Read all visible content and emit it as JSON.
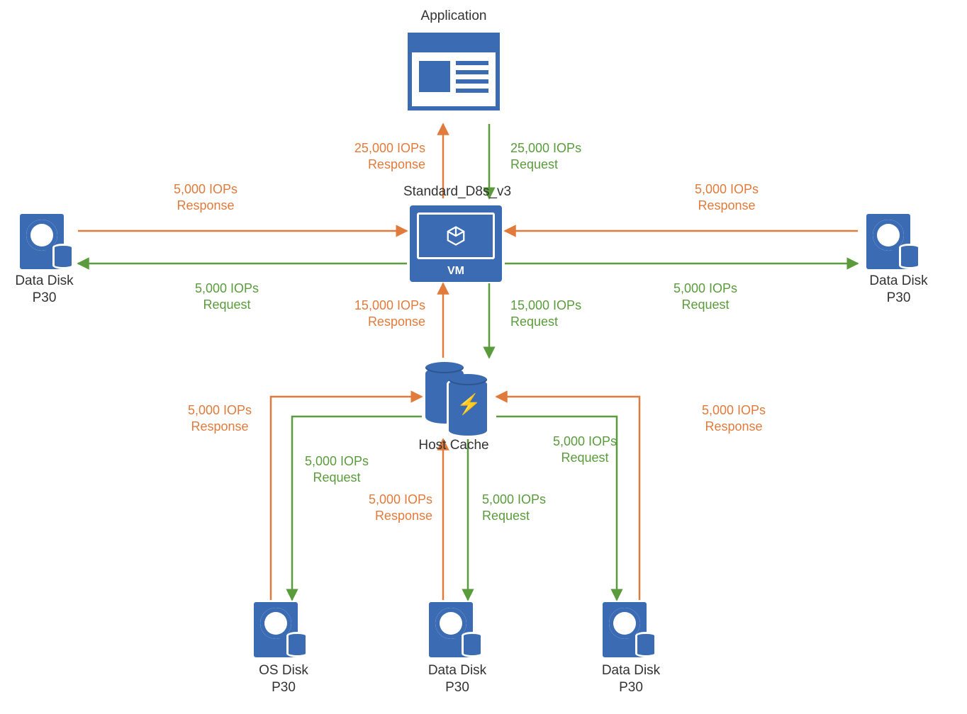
{
  "colors": {
    "orange": "#e07b3c",
    "green": "#5a9b3c",
    "blue": "#3b6cb3"
  },
  "nodes": {
    "application": {
      "label": "Application"
    },
    "vm": {
      "label_top": "Standard_D8s_v3",
      "label_inside": "VM"
    },
    "host_cache": {
      "label": "Host Cache"
    },
    "disk_left": {
      "line1": "Data Disk",
      "line2": "P30"
    },
    "disk_right": {
      "line1": "Data Disk",
      "line2": "P30"
    },
    "bottom_os": {
      "line1": "OS Disk",
      "line2": "P30"
    },
    "bottom_data1": {
      "line1": "Data Disk",
      "line2": "P30"
    },
    "bottom_data2": {
      "line1": "Data Disk",
      "line2": "P30"
    }
  },
  "flows": {
    "app_response": "25,000 IOPs\nResponse",
    "app_request": "25,000 IOPs\nRequest",
    "left_response": "5,000 IOPs\nResponse",
    "left_request": "5,000 IOPs\nRequest",
    "right_response": "5,000 IOPs\nResponse",
    "right_request": "5,000 IOPs\nRequest",
    "cache_response": "15,000 IOPs\nResponse",
    "cache_request": "15,000 IOPs\nRequest",
    "hc_left_resp": "5,000 IOPs\nResponse",
    "hc_left_req": "5,000 IOPs\nRequest",
    "hc_right_resp": "5,000 IOPs\nResponse",
    "hc_right_req": "5,000 IOPs\nRequest",
    "hc_mid_resp": "5,000 IOPs\nResponse",
    "hc_mid_req": "5,000 IOPs\nRequest"
  }
}
